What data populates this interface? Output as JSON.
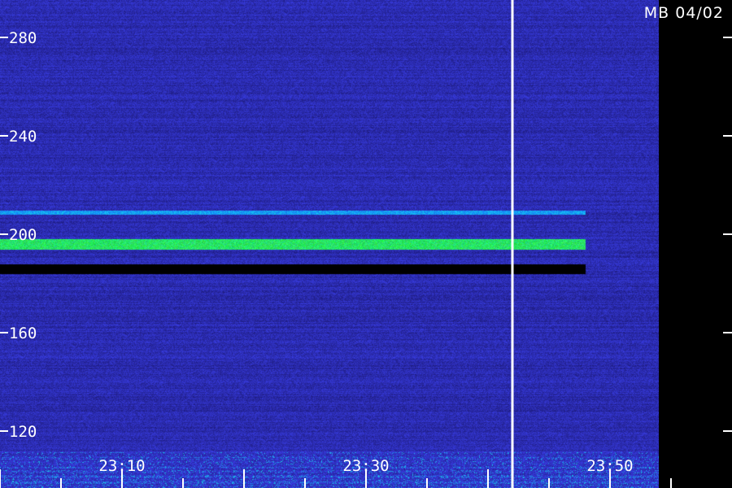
{
  "station_label": "MB 04/02",
  "colors": {
    "background": "#000000",
    "noise_low": "#1a1a7a",
    "noise_high": "#3a3ad0",
    "band_bright": "#22ff55",
    "band_mid": "#1aa0ff",
    "marker": "#ffffff"
  },
  "chart_data": {
    "type": "heatmap",
    "title": "",
    "xlabel": "",
    "ylabel": "",
    "y_ticks": [
      {
        "value": 120,
        "label": "120"
      },
      {
        "value": 160,
        "label": "160"
      },
      {
        "value": 200,
        "label": "200"
      },
      {
        "value": 240,
        "label": "240"
      },
      {
        "value": 280,
        "label": "280"
      }
    ],
    "x_ticks": [
      {
        "value": "23:10",
        "label": "23:10"
      },
      {
        "value": "23:30",
        "label": "23:30"
      },
      {
        "value": "23:50",
        "label": "23:50"
      }
    ],
    "ylim": [
      100,
      295
    ],
    "xlim": [
      "23:00",
      "23:56"
    ],
    "marker_time": "23:42",
    "signal_end_time": "23:48",
    "bands": [
      {
        "center": 196,
        "halfwidth": 2.2,
        "intensity": "high"
      },
      {
        "center": 209,
        "halfwidth": 0.8,
        "intensity": "medium"
      },
      {
        "center": 186,
        "halfwidth": 2.0,
        "intensity": "none"
      }
    ]
  }
}
